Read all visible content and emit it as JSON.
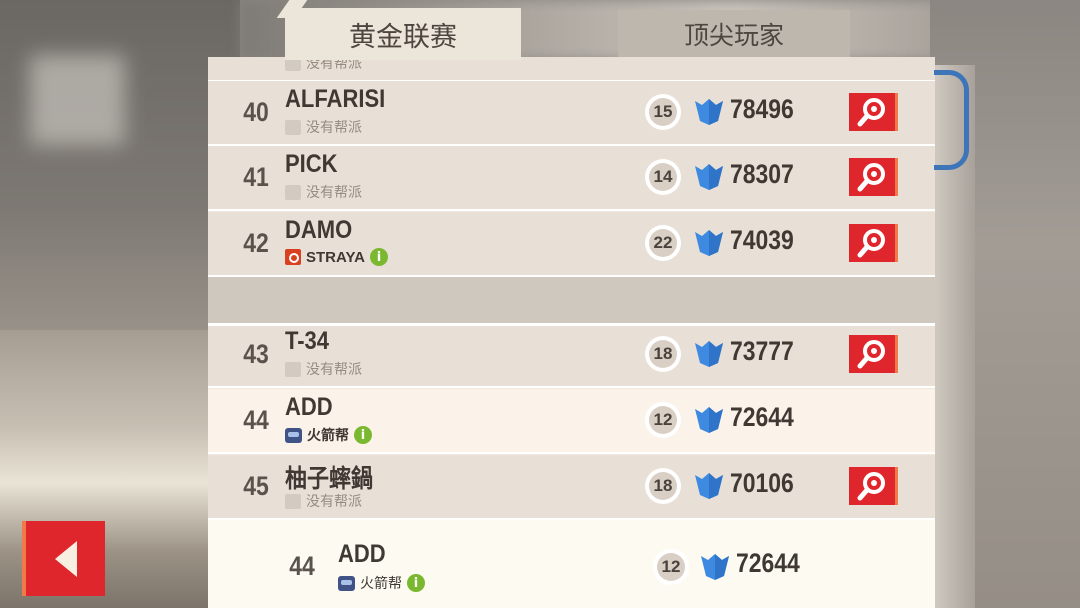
{
  "tabs": {
    "active": "黄金联赛",
    "inactive": "顶尖玩家"
  },
  "colors": {
    "accent_red": "#e0262d",
    "trophy_blue": "#3e8ae0",
    "info_green": "#7ab830",
    "clip_blue": "#3e74b8"
  },
  "clipped_top_text": "没有帮派",
  "rows": [
    {
      "rank": "40",
      "name": "ALFARISI",
      "gang": "没有帮派",
      "gang_type": "none",
      "level": "15",
      "score": "78496",
      "spy": true
    },
    {
      "rank": "41",
      "name": "PICK",
      "gang": "没有帮派",
      "gang_type": "none",
      "level": "14",
      "score": "78307",
      "spy": true
    },
    {
      "rank": "42",
      "name": "DAMO",
      "gang": "STRAYA",
      "gang_type": "red",
      "info": "i",
      "level": "22",
      "score": "74039",
      "spy": true
    },
    {
      "rank": "43",
      "name": "T-34",
      "gang": "没有帮派",
      "gang_type": "none",
      "level": "18",
      "score": "73777",
      "spy": true
    },
    {
      "rank": "44",
      "name": "ADD",
      "gang": "火箭帮",
      "gang_type": "blue",
      "info": "i",
      "level": "12",
      "score": "72644",
      "spy": false
    },
    {
      "rank": "45",
      "name": "柚子蟀鍋",
      "gang": "没有帮派",
      "gang_type": "none",
      "level": "18",
      "score": "70106",
      "spy": true
    }
  ],
  "self": {
    "rank": "44",
    "name": "ADD",
    "gang": "火箭帮",
    "info": "i",
    "level": "12",
    "score": "72644"
  },
  "icons": {
    "spy": "magnifier-icon",
    "trophy": "trophy-icon",
    "back": "back-arrow-icon"
  }
}
